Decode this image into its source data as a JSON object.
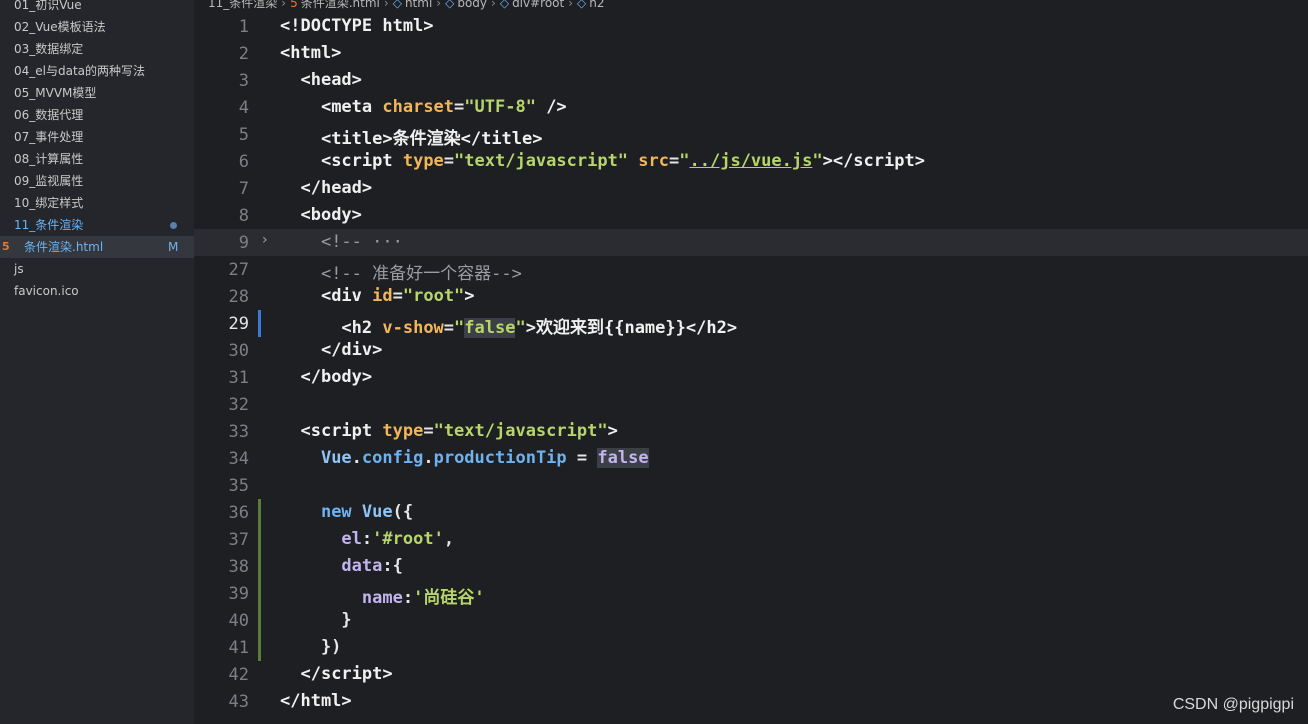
{
  "sidebar": {
    "items": [
      {
        "label": "01_初识Vue"
      },
      {
        "label": "02_Vue模板语法"
      },
      {
        "label": "03_数据绑定"
      },
      {
        "label": "04_el与data的两种写法"
      },
      {
        "label": "05_MVVM模型"
      },
      {
        "label": "06_数据代理"
      },
      {
        "label": "07_事件处理"
      },
      {
        "label": "08_计算属性"
      },
      {
        "label": "09_监视属性"
      },
      {
        "label": "10_绑定样式"
      },
      {
        "label": "11_条件渲染"
      },
      {
        "label": "条件渲染.html",
        "badge": "M"
      },
      {
        "label": "js"
      },
      {
        "label": "favicon.ico"
      }
    ]
  },
  "breadcrumb": {
    "items": [
      "11_条件渲染",
      "条件渲染.html",
      "html",
      "body",
      "div#root",
      "h2"
    ]
  },
  "editor": {
    "lines": [
      {
        "n": "1",
        "html": "<span class=\"t-tag\">&lt;!DOCTYPE html&gt;</span>"
      },
      {
        "n": "2",
        "html": "<span class=\"t-tag\">&lt;html&gt;</span>"
      },
      {
        "n": "3",
        "html": "  <span class=\"t-tag\">&lt;head&gt;</span>"
      },
      {
        "n": "4",
        "html": "    <span class=\"t-tag\">&lt;meta </span><span class=\"t-attr\">charset</span>=<span class=\"t-str\">\"UTF-8\"</span> <span class=\"t-tag\">/&gt;</span>"
      },
      {
        "n": "5",
        "html": "    <span class=\"t-tag\">&lt;title&gt;</span><span class=\"t-text\">条件渲染</span><span class=\"t-tag\">&lt;/title&gt;</span>"
      },
      {
        "n": "6",
        "html": "    <span class=\"t-tag\">&lt;script </span><span class=\"t-attr\">type</span>=<span class=\"t-str\">\"text/javascript\"</span> <span class=\"t-attr\">src</span>=<span class=\"t-str\">\"<span class=\"t-underline\">../js/vue.js</span>\"</span><span class=\"t-tag\">&gt;&lt;/script&gt;</span>"
      },
      {
        "n": "7",
        "html": "  <span class=\"t-tag\">&lt;/head&gt;</span>"
      },
      {
        "n": "8",
        "html": "  <span class=\"t-tag\">&lt;body&gt;</span>"
      },
      {
        "n": "9",
        "html": "    <span class=\"t-comment\">&lt;!-- ···</span>",
        "fold": true
      },
      {
        "n": "27",
        "html": "    <span class=\"t-comment\">&lt;!-- 准备好一个容器--&gt;</span>"
      },
      {
        "n": "28",
        "html": "    <span class=\"t-tag\">&lt;div </span><span class=\"t-attr\">id</span>=<span class=\"t-str\">\"root\"</span><span class=\"t-tag\">&gt;</span>"
      },
      {
        "n": "29",
        "html": "      <span class=\"t-tag\">&lt;h2 </span><span class=\"t-attr\">v-show</span>=<span class=\"t-str\">\"<span class=\"t-hl\">false</span>\"</span><span class=\"t-tag\">&gt;</span><span class=\"t-text\">欢迎来到{{name}}</span><span class=\"t-tag\">&lt;/h2&gt;</span>",
        "active": true
      },
      {
        "n": "30",
        "html": "    <span class=\"t-tag\">&lt;/div&gt;</span>"
      },
      {
        "n": "31",
        "html": "  <span class=\"t-tag\">&lt;/body&gt;</span>"
      },
      {
        "n": "32",
        "html": ""
      },
      {
        "n": "33",
        "html": "  <span class=\"t-tag\">&lt;script </span><span class=\"t-attr\">type</span>=<span class=\"t-str\">\"text/javascript\"</span><span class=\"t-tag\">&gt;</span>"
      },
      {
        "n": "34",
        "html": "    <span class=\"t-id\">Vue</span>.<span class=\"t-kw\">config</span>.<span class=\"t-kw\">productionTip</span> = <span class=\"t-prop t-hl\">false</span>"
      },
      {
        "n": "35",
        "html": ""
      },
      {
        "n": "36",
        "html": "    <span class=\"t-kw\">new</span> <span class=\"t-id\">Vue</span>({",
        "green": true
      },
      {
        "n": "37",
        "html": "      <span class=\"t-prop\">el</span>:<span class=\"t-str\">'#root'</span>,",
        "green": true
      },
      {
        "n": "38",
        "html": "      <span class=\"t-prop\">data</span>:{",
        "green": true
      },
      {
        "n": "39",
        "html": "        <span class=\"t-prop\">name</span>:<span class=\"t-str\">'尚硅谷'</span>",
        "green": true
      },
      {
        "n": "40",
        "html": "      }",
        "green": true
      },
      {
        "n": "41",
        "html": "    })",
        "green": true
      },
      {
        "n": "42",
        "html": "  <span class=\"t-tag\">&lt;/script&gt;</span>"
      },
      {
        "n": "43",
        "html": "<span class=\"t-tag\">&lt;/html&gt;</span>"
      }
    ]
  },
  "watermark": "CSDN @pigpigpi"
}
